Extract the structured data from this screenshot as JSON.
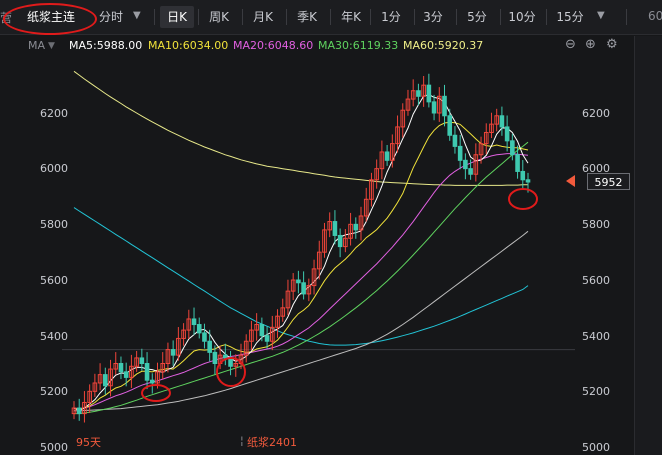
{
  "toolbar": {
    "left_stub": "营",
    "title": "纸浆主连",
    "tabs": [
      "分时",
      "日K",
      "周K",
      "月K",
      "季K",
      "年K",
      "1分",
      "3分",
      "5分",
      "10分",
      "15分"
    ],
    "active_tab": "日K",
    "right_stub": "60"
  },
  "ma_bar": {
    "label": "MA",
    "ma5": "MA5:5988.00",
    "ma10": "MA10:6034.00",
    "ma20": "MA20:6048.60",
    "ma30": "MA30:6119.33",
    "ma60": "MA60:5920.37",
    "colors": {
      "ma5": "#ffffff",
      "ma10": "#f0e23a",
      "ma20": "#e060e0",
      "ma30": "#5fd35f",
      "ma60": "#f0f08a"
    }
  },
  "icons": [
    "zoom-out-icon",
    "zoom-in-icon",
    "settings-icon"
  ],
  "price_tag": "5952",
  "footer": {
    "left_label": "95天",
    "contract_label": "纸浆2401"
  },
  "chart_data": {
    "type": "candlestick",
    "ylim": [
      5000,
      6350
    ],
    "yticks_left": [
      "6200",
      "6000",
      "5800",
      "5600",
      "5400",
      "5200",
      "5000"
    ],
    "yticks_right": [
      "6200",
      "6000",
      "5800",
      "5600",
      "5400",
      "5200",
      "5000"
    ],
    "last_price": 5952,
    "up_color": "#f0453a",
    "down_color": "#3fc9b0",
    "closes": [
      5140,
      5120,
      5160,
      5200,
      5230,
      5260,
      5220,
      5280,
      5300,
      5270,
      5250,
      5290,
      5320,
      5300,
      5240,
      5230,
      5270,
      5300,
      5350,
      5330,
      5390,
      5420,
      5460,
      5440,
      5410,
      5380,
      5340,
      5300,
      5330,
      5320,
      5290,
      5300,
      5330,
      5380,
      5420,
      5440,
      5400,
      5380,
      5430,
      5470,
      5500,
      5560,
      5600,
      5590,
      5550,
      5580,
      5640,
      5700,
      5780,
      5810,
      5760,
      5720,
      5750,
      5800,
      5780,
      5830,
      5890,
      5960,
      6000,
      6060,
      6030,
      6090,
      6150,
      6210,
      6250,
      6280,
      6260,
      6300,
      6240,
      6200,
      6260,
      6190,
      6120,
      6080,
      6030,
      6000,
      5980,
      6050,
      6090,
      6130,
      6160,
      6190,
      6150,
      6100,
      6050,
      5990,
      5960,
      5952
    ],
    "ma5": [
      5140,
      5130,
      5140,
      5155,
      5170,
      5194,
      5214,
      5238,
      5258,
      5266,
      5264,
      5278,
      5286,
      5286,
      5280,
      5278,
      5272,
      5268,
      5278,
      5286,
      5320,
      5356,
      5388,
      5404,
      5420,
      5422,
      5406,
      5376,
      5352,
      5334,
      5318,
      5308,
      5314,
      5326,
      5344,
      5374,
      5394,
      5404,
      5414,
      5424,
      5436,
      5468,
      5512,
      5544,
      5560,
      5576,
      5594,
      5614,
      5650,
      5700,
      5738,
      5754,
      5762,
      5766,
      5770,
      5776,
      5810,
      5852,
      5892,
      5938,
      5988,
      6028,
      6066,
      6108,
      6146,
      6196,
      6230,
      6260,
      6266,
      6256,
      6252,
      6238,
      6202,
      6170,
      6136,
      6086,
      6042,
      6028,
      6030,
      6048,
      6082,
      6124,
      6146,
      6146,
      6130,
      6098,
      6050,
      6020
    ],
    "ma10": [
      5140,
      5135,
      5140,
      5148,
      5160,
      5176,
      5186,
      5200,
      5212,
      5218,
      5230,
      5246,
      5262,
      5272,
      5272,
      5270,
      5276,
      5278,
      5282,
      5280,
      5294,
      5310,
      5328,
      5345,
      5350,
      5348,
      5350,
      5352,
      5362,
      5368,
      5360,
      5350,
      5344,
      5340,
      5342,
      5352,
      5356,
      5360,
      5370,
      5384,
      5406,
      5431,
      5458,
      5479,
      5492,
      5508,
      5536,
      5567,
      5597,
      5622,
      5643,
      5659,
      5675,
      5694,
      5716,
      5732,
      5752,
      5766,
      5781,
      5802,
      5822,
      5849,
      5878,
      5911,
      5958,
      6003,
      6040,
      6078,
      6114,
      6138,
      6155,
      6164,
      6167,
      6165,
      6159,
      6142,
      6125,
      6107,
      6090,
      6083,
      6080,
      6085,
      6080,
      6077,
      6075,
      6075,
      6071,
      6067
    ],
    "ma20": [
      5140,
      5138,
      5140,
      5145,
      5152,
      5160,
      5168,
      5176,
      5184,
      5190,
      5197,
      5205,
      5214,
      5222,
      5228,
      5233,
      5238,
      5244,
      5250,
      5256,
      5262,
      5268,
      5276,
      5284,
      5292,
      5300,
      5306,
      5312,
      5318,
      5322,
      5325,
      5328,
      5332,
      5336,
      5340,
      5344,
      5348,
      5352,
      5356,
      5362,
      5370,
      5380,
      5392,
      5404,
      5416,
      5428,
      5444,
      5460,
      5478,
      5496,
      5514,
      5532,
      5550,
      5568,
      5586,
      5604,
      5622,
      5640,
      5658,
      5678,
      5698,
      5718,
      5740,
      5762,
      5786,
      5810,
      5836,
      5862,
      5888,
      5914,
      5938,
      5958,
      5976,
      5990,
      6002,
      6012,
      6020,
      6028,
      6034,
      6040,
      6046,
      6050,
      6052,
      6054,
      6054,
      6052,
      6050,
      6048
    ],
    "ma30": [
      5120,
      5120,
      5122,
      5125,
      5128,
      5132,
      5136,
      5140,
      5145,
      5150,
      5156,
      5162,
      5168,
      5175,
      5182,
      5188,
      5194,
      5200,
      5206,
      5212,
      5218,
      5224,
      5230,
      5236,
      5242,
      5248,
      5254,
      5260,
      5266,
      5272,
      5278,
      5284,
      5290,
      5296,
      5302,
      5308,
      5314,
      5320,
      5326,
      5333,
      5340,
      5348,
      5357,
      5366,
      5376,
      5386,
      5397,
      5408,
      5420,
      5432,
      5445,
      5458,
      5472,
      5486,
      5500,
      5515,
      5530,
      5546,
      5562,
      5579,
      5596,
      5614,
      5632,
      5651,
      5670,
      5690,
      5710,
      5730,
      5751,
      5772,
      5793,
      5814,
      5835,
      5856,
      5876,
      5896,
      5915,
      5934,
      5952,
      5970,
      5986,
      6002,
      6018,
      6034,
      6050,
      6066,
      6080,
      6095
    ],
    "ma60": [
      5130,
      5130,
      5131,
      5132,
      5133,
      5134,
      5135,
      5136,
      5137,
      5138,
      5140,
      5142,
      5144,
      5146,
      5148,
      5150,
      5152,
      5155,
      5158,
      5161,
      5164,
      5168,
      5172,
      5176,
      5180,
      5184,
      5189,
      5194,
      5199,
      5204,
      5210,
      5216,
      5222,
      5228,
      5234,
      5240,
      5246,
      5252,
      5258,
      5264,
      5270,
      5276,
      5282,
      5288,
      5294,
      5300,
      5306,
      5312,
      5318,
      5324,
      5330,
      5336,
      5342,
      5348,
      5354,
      5361,
      5368,
      5376,
      5385,
      5395,
      5405,
      5416,
      5428,
      5440,
      5453,
      5466,
      5480,
      5494,
      5508,
      5522,
      5536,
      5550,
      5564,
      5578,
      5592,
      5606,
      5620,
      5634,
      5648,
      5662,
      5676,
      5690,
      5704,
      5718,
      5732,
      5746,
      5760,
      5775
    ],
    "ma120": [
      6350,
      6336,
      6322,
      6309,
      6296,
      6283,
      6270,
      6258,
      6246,
      6234,
      6222,
      6211,
      6200,
      6189,
      6178,
      6168,
      6158,
      6148,
      6138,
      6129,
      6120,
      6111,
      6102,
      6094,
      6086,
      6078,
      6071,
      6064,
      6057,
      6050,
      6044,
      6038,
      6032,
      6027,
      6022,
      6017,
      6013,
      6009,
      6006,
      6003,
      6000,
      5997,
      5994,
      5991,
      5988,
      5985,
      5982,
      5979,
      5976,
      5973,
      5970,
      5968,
      5966,
      5964,
      5962,
      5960,
      5958,
      5956,
      5954,
      5952,
      5951,
      5950,
      5949,
      5948,
      5947,
      5946,
      5945,
      5944,
      5943,
      5942,
      5942,
      5941,
      5941,
      5940,
      5940,
      5940,
      5940,
      5940,
      5940,
      5940,
      5940,
      5940,
      5940,
      5941,
      5941,
      5941,
      5942,
      5942
    ],
    "ma250": [
      5860,
      5848,
      5836,
      5824,
      5812,
      5800,
      5788,
      5776,
      5764,
      5752,
      5740,
      5728,
      5716,
      5704,
      5692,
      5680,
      5668,
      5656,
      5644,
      5632,
      5620,
      5608,
      5596,
      5584,
      5572,
      5560,
      5548,
      5536,
      5524,
      5512,
      5500,
      5490,
      5480,
      5470,
      5460,
      5450,
      5442,
      5434,
      5426,
      5418,
      5410,
      5404,
      5398,
      5392,
      5386,
      5380,
      5376,
      5372,
      5369,
      5367,
      5366,
      5366,
      5366,
      5367,
      5368,
      5370,
      5372,
      5375,
      5378,
      5382,
      5386,
      5390,
      5395,
      5400,
      5405,
      5410,
      5416,
      5422,
      5428,
      5434,
      5441,
      5448,
      5455,
      5462,
      5470,
      5478,
      5486,
      5494,
      5502,
      5510,
      5518,
      5526,
      5534,
      5542,
      5550,
      5558,
      5566,
      5580
    ]
  }
}
